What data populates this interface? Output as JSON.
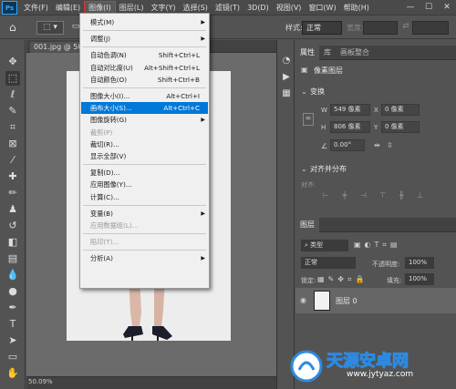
{
  "menubar": {
    "logo": "Ps",
    "items": [
      "文件(F)",
      "编辑(E)",
      "图像(I)",
      "图层(L)",
      "文字(Y)",
      "选择(S)",
      "滤镜(T)",
      "3D(D)",
      "视图(V)",
      "窗口(W)",
      "帮助(H)"
    ],
    "active_index": 2,
    "window_controls": [
      "—",
      "☐",
      "✕"
    ]
  },
  "optionsbar": {
    "style_label": "样式:",
    "style_value": "正常",
    "width_label": "宽度:"
  },
  "document": {
    "tab_title": "001.jpg @ 50%",
    "zoom": "50.09%"
  },
  "image_menu": {
    "items": [
      {
        "label": "模式(M)",
        "shortcut": "",
        "submenu": true,
        "disabled": false
      },
      {
        "sep": true
      },
      {
        "label": "调整(J)",
        "shortcut": "",
        "submenu": true,
        "disabled": false
      },
      {
        "sep": true
      },
      {
        "label": "自动色调(N)",
        "shortcut": "Shift+Ctrl+L",
        "disabled": false
      },
      {
        "label": "自动对比度(U)",
        "shortcut": "Alt+Shift+Ctrl+L",
        "disabled": false
      },
      {
        "label": "自动颜色(O)",
        "shortcut": "Shift+Ctrl+B",
        "disabled": false
      },
      {
        "sep": true
      },
      {
        "label": "图像大小(I)...",
        "shortcut": "Alt+Ctrl+I",
        "disabled": false
      },
      {
        "label": "画布大小(S)...",
        "shortcut": "Alt+Ctrl+C",
        "disabled": false,
        "highlighted": true
      },
      {
        "label": "图像旋转(G)",
        "shortcut": "",
        "submenu": true,
        "disabled": false
      },
      {
        "label": "裁剪(P)",
        "shortcut": "",
        "disabled": true
      },
      {
        "label": "裁切(R)...",
        "shortcut": "",
        "disabled": false
      },
      {
        "label": "显示全部(V)",
        "shortcut": "",
        "disabled": false
      },
      {
        "sep": true
      },
      {
        "label": "复制(D)...",
        "shortcut": "",
        "disabled": false
      },
      {
        "label": "应用图像(Y)...",
        "shortcut": "",
        "disabled": false
      },
      {
        "label": "计算(C)...",
        "shortcut": "",
        "disabled": false
      },
      {
        "sep": true
      },
      {
        "label": "变量(B)",
        "shortcut": "",
        "submenu": true,
        "disabled": false
      },
      {
        "label": "应用数据组(L)...",
        "shortcut": "",
        "disabled": true
      },
      {
        "sep": true
      },
      {
        "label": "陷印(T)...",
        "shortcut": "",
        "disabled": true
      },
      {
        "sep": true
      },
      {
        "label": "分析(A)",
        "shortcut": "",
        "submenu": true,
        "disabled": false
      }
    ]
  },
  "properties_panel": {
    "tabs": [
      "属性",
      "库",
      "画板整合"
    ],
    "active_tab": 0,
    "layer_type": "像素图层",
    "transform_title": "变换",
    "w_label": "W",
    "w_value": "549 像素",
    "x_label": "X",
    "x_value": "0 像素",
    "h_label": "H",
    "h_value": "806 像素",
    "y_label": "Y",
    "y_value": "0 像素",
    "angle_value": "0.00°",
    "align_title": "对齐并分布",
    "align_label": "对齐:"
  },
  "layers_panel": {
    "tab": "图层",
    "filter_kind": "类型",
    "blend_mode": "正常",
    "opacity_label": "不透明度:",
    "opacity_value": "100%",
    "lock_label": "锁定:",
    "fill_label": "填充:",
    "fill_value": "100%",
    "layer_name": "图层 0"
  },
  "watermark": {
    "brand": "天源安卓网",
    "url": "www.jytyaz.com"
  }
}
